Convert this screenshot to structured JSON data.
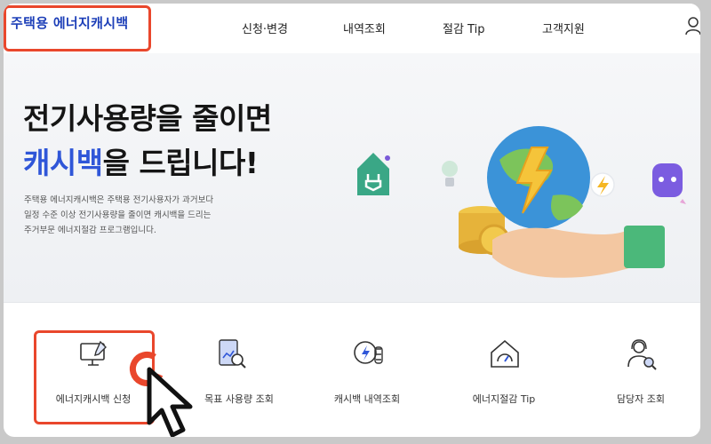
{
  "header": {
    "logo": "주택용 에너지캐시백",
    "nav": [
      "신청·변경",
      "내역조회",
      "절감 Tip",
      "고객지원"
    ],
    "user_icon": "user-icon"
  },
  "hero": {
    "headline_line1": "전기사용량을 줄이면",
    "headline_accent": "캐시백",
    "headline_rest": "을 드립니다!",
    "description": "주택용 에너지캐시백은 주택용 전기사용자가 과거보다\n일정 수준 이상 전기사용량을 줄이면 캐시백을 드리는\n주거부문 에너지절감 프로그램입니다."
  },
  "quick_menu": [
    {
      "label": "에너지캐시백 신청",
      "icon": "monitor-pen-icon"
    },
    {
      "label": "목표 사용량 조회",
      "icon": "report-search-icon"
    },
    {
      "label": "캐시백 내역조회",
      "icon": "coins-bolt-icon"
    },
    {
      "label": "에너지절감 Tip",
      "icon": "house-gauge-icon"
    },
    {
      "label": "담당자 조회",
      "icon": "person-search-icon"
    }
  ],
  "colors": {
    "accent": "#2f56d8",
    "highlight": "#e9472c",
    "logo": "#1d3fb8"
  }
}
